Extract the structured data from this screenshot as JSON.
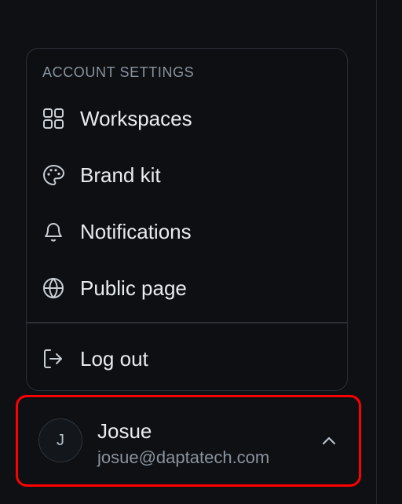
{
  "menu": {
    "header": "ACCOUNT SETTINGS",
    "items": [
      {
        "label": "Workspaces",
        "icon": "grid-icon"
      },
      {
        "label": "Brand kit",
        "icon": "palette-icon"
      },
      {
        "label": "Notifications",
        "icon": "bell-icon"
      },
      {
        "label": "Public page",
        "icon": "globe-icon"
      }
    ],
    "logout": {
      "label": "Log out",
      "icon": "logout-icon"
    }
  },
  "user": {
    "initial": "J",
    "name": "Josue",
    "email": "josue@daptatech.com",
    "toggle_icon": "chevron-up-icon"
  },
  "colors": {
    "background": "#0e1013",
    "card_border": "#2b3037",
    "text_primary": "#e9ecef",
    "text_secondary": "#8a939e",
    "highlight": "#ff0000"
  }
}
